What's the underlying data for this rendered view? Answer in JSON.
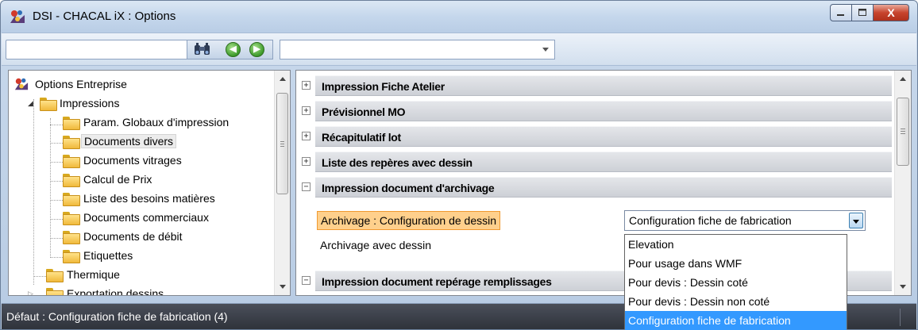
{
  "window": {
    "title": "DSI - CHACAL iX : Options",
    "close_label": "X"
  },
  "toolbar": {
    "search_value": "",
    "combo_value": "",
    "icons": [
      "binoculars-icon",
      "back-arrow-icon",
      "forward-arrow-icon"
    ]
  },
  "tree": {
    "root": "Options Entreprise",
    "items": [
      {
        "label": "Impressions"
      },
      {
        "label": "Param. Globaux d'impression"
      },
      {
        "label": "Documents divers",
        "selected": true
      },
      {
        "label": "Documents vitrages"
      },
      {
        "label": "Calcul de Prix"
      },
      {
        "label": "Liste des besoins matières"
      },
      {
        "label": "Documents commerciaux"
      },
      {
        "label": "Documents de débit"
      },
      {
        "label": "Etiquettes"
      },
      {
        "label": "Thermique"
      },
      {
        "label": "Exportation dessins"
      }
    ]
  },
  "sections": [
    {
      "label": "Impression Fiche Atelier",
      "expanded": false
    },
    {
      "label": "Prévisionnel MO",
      "expanded": false
    },
    {
      "label": "Récapitulatif lot",
      "expanded": false
    },
    {
      "label": "Liste des repères avec dessin",
      "expanded": false
    },
    {
      "label": "Impression document d'archivage",
      "expanded": true
    },
    {
      "label": "Impression document repérage remplissages",
      "expanded": true
    }
  ],
  "properties": [
    {
      "label": "Archivage : Configuration de dessin",
      "value": "Configuration fiche de fabrication",
      "highlighted": true
    },
    {
      "label": "Archivage avec dessin",
      "value": ""
    }
  ],
  "dropdown": {
    "options": [
      "Elevation",
      "Pour usage dans WMF",
      "Pour devis : Dessin coté",
      "Pour devis : Dessin non coté",
      "Configuration fiche de fabrication"
    ],
    "selected_index": 4
  },
  "status": {
    "text": "Défaut : Configuration fiche de fabrication (4)"
  },
  "colors": {
    "highlight": "#ffd08c",
    "selection": "#3399ff",
    "statusbar": "#2f333b"
  }
}
